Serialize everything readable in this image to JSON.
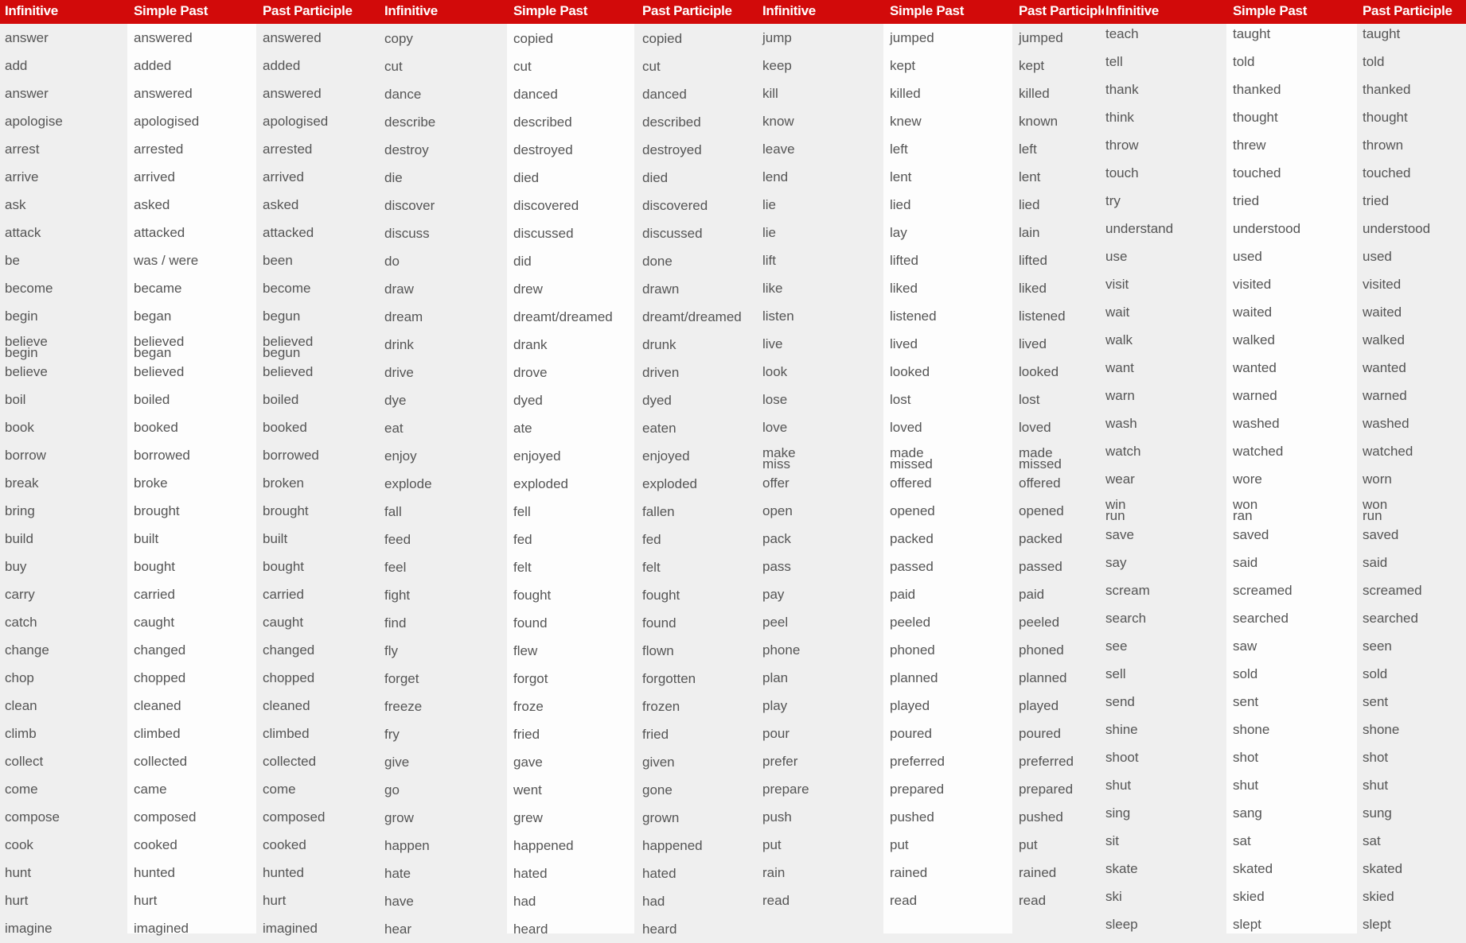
{
  "headers": [
    "Infinitive",
    "Simple Past",
    "Past Participle"
  ],
  "colors": {
    "header_bg": "#d20a0a",
    "header_text": "#ffffff",
    "text": "#555555",
    "stripe_light": "#fdfdfd",
    "stripe_gray": "#efefef"
  },
  "groups": [
    {
      "rows": [
        [
          "answer",
          "answered",
          "answered"
        ],
        [
          "add",
          "added",
          "added"
        ],
        [
          "answer",
          "answered",
          "answered"
        ],
        [
          "apologise",
          "apologised",
          "apologised"
        ],
        [
          "arrest",
          "arrested",
          "arrested"
        ],
        [
          "arrive",
          "arrived",
          "arrived"
        ],
        [
          "ask",
          "asked",
          "asked"
        ],
        [
          "attack",
          "attacked",
          "attacked"
        ],
        [
          "be",
          "was / were",
          "been"
        ],
        [
          "become",
          "became",
          "become"
        ],
        [
          "begin",
          "began",
          "begun"
        ],
        [
          "believe\nbegin",
          "believed\nbegan",
          "believed\nbegun"
        ],
        [
          "believe",
          "believed",
          "believed"
        ],
        [
          "boil",
          "boiled",
          "boiled"
        ],
        [
          "book",
          "booked",
          "booked"
        ],
        [
          "borrow",
          "borrowed",
          "borrowed"
        ],
        [
          "break",
          "broke",
          "broken"
        ],
        [
          "bring",
          "brought",
          "brought"
        ],
        [
          "build",
          "built",
          "built"
        ],
        [
          "buy",
          "bought",
          "bought"
        ],
        [
          "carry",
          "carried",
          "carried"
        ],
        [
          "catch",
          "caught",
          "caught"
        ],
        [
          "change",
          "changed",
          "changed"
        ],
        [
          "chop",
          "chopped",
          "chopped"
        ],
        [
          "clean",
          "cleaned",
          "cleaned"
        ],
        [
          "climb",
          "climbed",
          "climbed"
        ],
        [
          "collect",
          "collected",
          "collected"
        ],
        [
          "come",
          "came",
          "come"
        ],
        [
          "compose",
          "composed",
          "composed"
        ],
        [
          "cook",
          "cooked",
          "cooked"
        ],
        [
          "hunt",
          "hunted",
          "hunted"
        ],
        [
          "hurt",
          "hurt",
          "hurt"
        ],
        [
          "imagine",
          "imagined",
          "imagined"
        ]
      ]
    },
    {
      "rows": [
        [
          "copy",
          "copied",
          "copied"
        ],
        [
          "cut",
          "cut",
          "cut"
        ],
        [
          "dance",
          "danced",
          "danced"
        ],
        [
          "describe",
          "described",
          "described"
        ],
        [
          "destroy",
          "destroyed",
          "destroyed"
        ],
        [
          "die",
          "died",
          "died"
        ],
        [
          "discover",
          "discovered",
          "discovered"
        ],
        [
          "discuss",
          "discussed",
          "discussed"
        ],
        [
          "do",
          "did",
          "done"
        ],
        [
          "draw",
          "drew",
          "drawn"
        ],
        [
          "dream",
          "dreamt/dreamed",
          "dreamt/dreamed"
        ],
        [
          "drink",
          "drank",
          "drunk"
        ],
        [
          "drive",
          "drove",
          "driven"
        ],
        [
          "dye",
          "dyed",
          "dyed"
        ],
        [
          "eat",
          "ate",
          "eaten"
        ],
        [
          "enjoy",
          "enjoyed",
          "enjoyed"
        ],
        [
          "explode",
          "exploded",
          "exploded"
        ],
        [
          "fall",
          "fell",
          "fallen"
        ],
        [
          "feed",
          "fed",
          "fed"
        ],
        [
          "feel",
          "felt",
          "felt"
        ],
        [
          "fight",
          "fought",
          "fought"
        ],
        [
          "find",
          "found",
          "found"
        ],
        [
          "fly",
          "flew",
          "flown"
        ],
        [
          "forget",
          "forgot",
          "forgotten"
        ],
        [
          "freeze",
          "froze",
          "frozen"
        ],
        [
          "fry",
          "fried",
          "fried"
        ],
        [
          "give",
          "gave",
          "given"
        ],
        [
          "go",
          "went",
          "gone"
        ],
        [
          "grow",
          "grew",
          "grown"
        ],
        [
          "happen",
          "happened",
          "happened"
        ],
        [
          "hate",
          "hated",
          "hated"
        ],
        [
          "have",
          "had",
          "had"
        ],
        [
          "hear",
          "heard",
          "heard"
        ]
      ]
    },
    {
      "rows": [
        [
          "jump",
          "jumped",
          "jumped"
        ],
        [
          "keep",
          "kept",
          "kept"
        ],
        [
          "kill",
          "killed",
          "killed"
        ],
        [
          "know",
          "knew",
          "known"
        ],
        [
          "leave",
          "left",
          "left"
        ],
        [
          "lend",
          "lent",
          "lent"
        ],
        [
          "lie",
          "lied",
          "lied"
        ],
        [
          "lie",
          "lay",
          "lain"
        ],
        [
          "lift",
          "lifted",
          "lifted"
        ],
        [
          "like",
          "liked",
          "liked"
        ],
        [
          "listen",
          "listened",
          "listened"
        ],
        [
          "live",
          "lived",
          "lived"
        ],
        [
          "look",
          "looked",
          "looked"
        ],
        [
          "lose",
          "lost",
          "lost"
        ],
        [
          "love",
          "loved",
          "loved"
        ],
        [
          "make\nmiss",
          "made\nmissed",
          "made\nmissed"
        ],
        [
          "offer",
          "offered",
          "offered"
        ],
        [
          "open",
          "opened",
          "opened"
        ],
        [
          "pack",
          "packed",
          "packed"
        ],
        [
          "pass",
          "passed",
          "passed"
        ],
        [
          "pay",
          "paid",
          "paid"
        ],
        [
          "peel",
          "peeled",
          "peeled"
        ],
        [
          "phone",
          "phoned",
          "phoned"
        ],
        [
          "plan",
          "planned",
          "planned"
        ],
        [
          "play",
          "played",
          "played"
        ],
        [
          "pour",
          "poured",
          "poured"
        ],
        [
          "prefer",
          "preferred",
          "preferred"
        ],
        [
          "prepare",
          "prepared",
          "prepared"
        ],
        [
          "push",
          "pushed",
          "pushed"
        ],
        [
          "put",
          "put",
          "put"
        ],
        [
          "rain",
          "rained",
          "rained"
        ],
        [
          "read",
          "read",
          "read"
        ]
      ]
    },
    {
      "rows": [
        [
          "teach",
          "taught",
          "taught"
        ],
        [
          "tell",
          "told",
          "told"
        ],
        [
          "thank",
          "thanked",
          "thanked"
        ],
        [
          "think",
          "thought",
          "thought"
        ],
        [
          "throw",
          "threw",
          "thrown"
        ],
        [
          "touch",
          "touched",
          "touched"
        ],
        [
          "try",
          "tried",
          "tried"
        ],
        [
          "understand",
          "understood",
          "understood"
        ],
        [
          "use",
          "used",
          "used"
        ],
        [
          "visit",
          "visited",
          "visited"
        ],
        [
          "wait",
          "waited",
          "waited"
        ],
        [
          "walk",
          "walked",
          "walked"
        ],
        [
          "want",
          "wanted",
          "wanted"
        ],
        [
          "warn",
          "warned",
          "warned"
        ],
        [
          "wash",
          "washed",
          "washed"
        ],
        [
          "watch",
          "watched",
          "watched"
        ],
        [
          "wear",
          "wore",
          "worn"
        ],
        [
          "win\nrun",
          "won\nran",
          "won\nrun"
        ],
        [
          "save",
          "saved",
          "saved"
        ],
        [
          "say",
          "said",
          "said"
        ],
        [
          "scream",
          "screamed",
          "screamed"
        ],
        [
          "search",
          "searched",
          "searched"
        ],
        [
          "see",
          "saw",
          "seen"
        ],
        [
          "sell",
          "sold",
          "sold"
        ],
        [
          "send",
          "sent",
          "sent"
        ],
        [
          "shine",
          "shone",
          "shone"
        ],
        [
          "shoot",
          "shot",
          "shot"
        ],
        [
          "shut",
          "shut",
          "shut"
        ],
        [
          "sing",
          "sang",
          "sung"
        ],
        [
          "sit",
          "sat",
          "sat"
        ],
        [
          "skate",
          "skated",
          "skated"
        ],
        [
          "ski",
          "skied",
          "skied"
        ],
        [
          "sleep",
          "slept",
          "slept"
        ]
      ]
    }
  ]
}
